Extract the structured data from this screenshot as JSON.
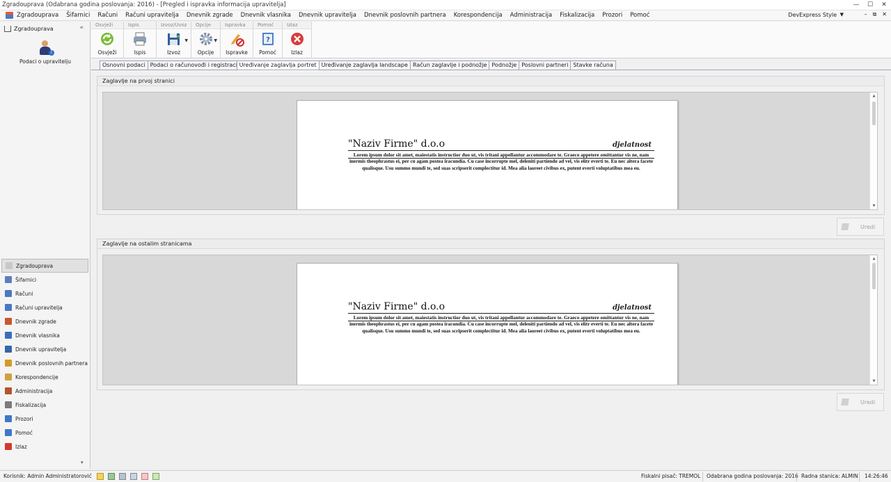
{
  "window": {
    "title": "Zgradouprava (Odabrana godina poslovanja: 2016) - [Pregled i ispravka informacija upravitelja]",
    "minimize": "—",
    "maximize": "☐",
    "close": "✕"
  },
  "menu": {
    "items": [
      "Zgradouprava",
      "Šifarnici",
      "Računi",
      "Računi upravitelja",
      "Dnevnik zgrade",
      "Dnevnik vlasnika",
      "Dnevnik upravitelja",
      "Dnevnik poslovnih partnera",
      "Korespondencija",
      "Administracija",
      "Fiskalizacija",
      "Prozori",
      "Pomoć"
    ],
    "style_label": "DevExpress Style",
    "style_arrow": "▼",
    "mdi_minimize": "–",
    "mdi_restore": "⧉",
    "mdi_close": "✕"
  },
  "left_panel": {
    "header": "Zgradouprava",
    "collapse": "«",
    "tile_label": "Podaci o upravitelju",
    "tile_badge": "i",
    "nav": [
      {
        "label": "Zgradouprava",
        "color": "#c8c8c8"
      },
      {
        "label": "Šifarnici",
        "color": "#5b7fb9"
      },
      {
        "label": "Računi",
        "color": "#4b78c0"
      },
      {
        "label": "Računi upravitelja",
        "color": "#4b78c0"
      },
      {
        "label": "Dnevnik zgrade",
        "color": "#c9562e"
      },
      {
        "label": "Dnevnik vlasnika",
        "color": "#3a6fb8"
      },
      {
        "label": "Dnevnik upravitelja",
        "color": "#3566a8"
      },
      {
        "label": "Dnevnik poslovnih partnera",
        "color": "#d49a2a"
      },
      {
        "label": "Korespondencije",
        "color": "#d0a040"
      },
      {
        "label": "Administracija",
        "color": "#b4542e"
      },
      {
        "label": "Fiskalizacija",
        "color": "#7b7b7b"
      },
      {
        "label": "Prozori",
        "color": "#3f76c9"
      },
      {
        "label": "Pomoć",
        "color": "#3f76c9"
      },
      {
        "label": "Izlaz",
        "color": "#d23a2a"
      }
    ],
    "scroll_down": "▾"
  },
  "toolbar": {
    "groups": [
      {
        "name": "Osvježi",
        "label": "Osvježi"
      },
      {
        "name": "Ispis",
        "label": "Ispis"
      },
      {
        "name": "Izvoz/Uvoz",
        "label": "Izvoz"
      },
      {
        "name": "Opcije",
        "label": "Opcije"
      },
      {
        "name": "Ispravka",
        "label": "Ispravke"
      },
      {
        "name": "Pomoć",
        "label": "Pomoć"
      },
      {
        "name": "Izlaz",
        "label": "Izlaz"
      }
    ],
    "dropdown_arrow": "▼"
  },
  "tabs": [
    {
      "label": "Osnovni podaci",
      "active": false
    },
    {
      "label": "Podaci o računovođi i registraciji",
      "active": false
    },
    {
      "label": "Uređivanje zaglavlja portret",
      "active": true
    },
    {
      "label": "Uređivanje zaglavlja landscape",
      "active": false
    },
    {
      "label": "Račun zaglavlje i podnožje",
      "active": false
    },
    {
      "label": "Podnožje",
      "active": false
    },
    {
      "label": "Poslovni partneri",
      "active": false
    },
    {
      "label": "Stavke računa",
      "active": false
    }
  ],
  "sections": [
    {
      "title": "Zaglavlje na prvoj stranici",
      "firm": "\"Naziv Firme\" d.o.o",
      "activity": "djelatnost",
      "lorem": "Lorem ipsum dolor sit amet, maiestatis instructior duo ut, vis tritani appellantur accommodare te. Graeco appetere omittantur vis ne, nam inermis theophrastus ei, per cu agam postea iracundia. Cu case incorrupte mel, deleniti partiendo ad vel, vis elitr everti te. Eu nec altera facete qualisque. Usu summo mundi te, sed suas scripserit complectitur id. Mea alia laoreet civibus ex, putent everti voluptatibus mea eu.",
      "button": "Uredi"
    },
    {
      "title": "Zaglavlje na ostalim stranicama",
      "firm": "\"Naziv Firme\" d.o.o",
      "activity": "djelatnost",
      "lorem": "Lorem ipsum dolor sit amet, maiestatis instructior duo ut, vis tritani appellantur accommodare te. Graeco appetere omittantur vis ne, nam inermis theophrastus ei, per cu agam postea iracundia. Cu case incorrupte mel, deleniti partiendo ad vel, vis elitr everti te. Eu nec altera facete qualisque. Usu summo mundi te, sed suas scripserit complectitur id. Mea alia laoreet civibus ex, putent everti voluptatibus mea eu.",
      "button": "Uredi"
    }
  ],
  "scroll": {
    "up": "▲",
    "down": "▼"
  },
  "status": {
    "user": "Korisnik: Admin Administratorović",
    "printer": "Fiskalni pisač: TREMOL",
    "year": "Odabrana godina poslovanja: 2016",
    "station": "Radna stanica: ALMIN",
    "time": "14:26:46"
  }
}
